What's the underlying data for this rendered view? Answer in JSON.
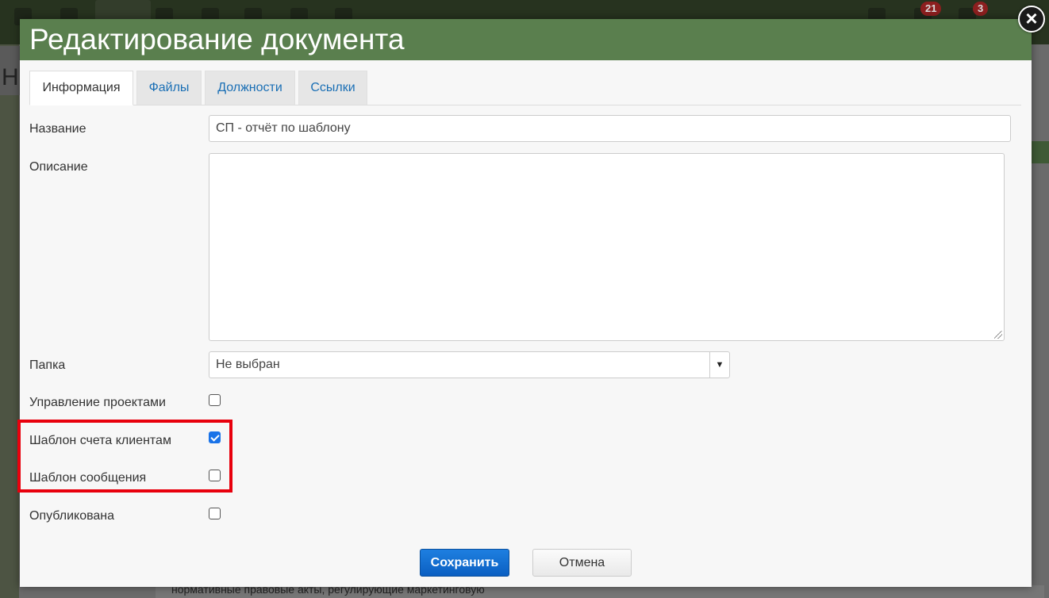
{
  "background": {
    "badges": [
      "21",
      "3"
    ],
    "page_heading_fragment": "Н",
    "bottom_text": "нормативные правовые акты, регулирующие маркетинговую"
  },
  "dialog": {
    "title": "Редактирование документа",
    "close_symbol": "×",
    "tabs": [
      {
        "label": "Информация",
        "active": true
      },
      {
        "label": "Файлы",
        "active": false
      },
      {
        "label": "Должности",
        "active": false
      },
      {
        "label": "Ссылки",
        "active": false
      }
    ],
    "fields": {
      "name_label": "Название",
      "name_value": "СП - отчёт по шаблону",
      "description_label": "Описание",
      "description_value": "",
      "folder_label": "Папка",
      "folder_value": "Не выбран",
      "project_mgmt_label": "Управление проектами",
      "project_mgmt_checked": false,
      "invoice_template_label": "Шаблон счета клиентам",
      "invoice_template_checked": true,
      "message_template_label": "Шаблон сообщения",
      "message_template_checked": false,
      "published_label": "Опубликована",
      "published_checked": false
    },
    "buttons": {
      "save": "Сохранить",
      "cancel": "Отмена"
    }
  },
  "colors": {
    "header": "#5a7f4e",
    "primary_button": "#0b5fc2",
    "highlight": "#e8000d",
    "link": "#1a6fb5"
  }
}
